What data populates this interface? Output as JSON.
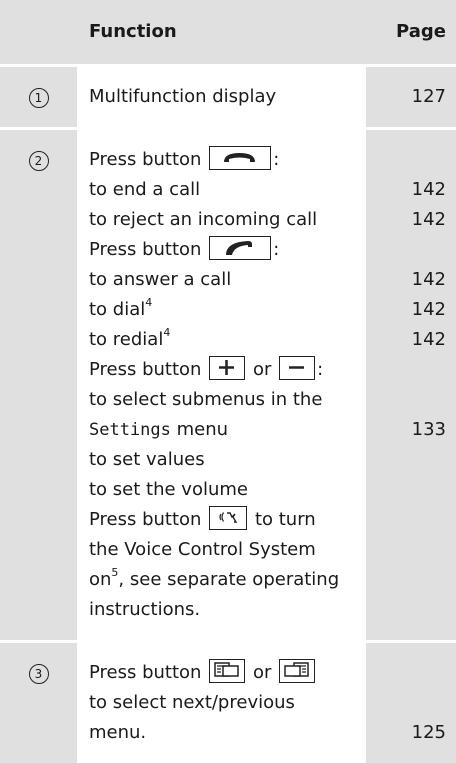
{
  "header": {
    "function": "Function",
    "page": "Page"
  },
  "rows": [
    {
      "num": "1",
      "lines": [
        {
          "t": "Multifunction display",
          "p": "127"
        }
      ]
    },
    {
      "num": "2",
      "lines": [
        {
          "pre": "Press button",
          "post": ":"
        },
        {
          "t": "to end a call",
          "p": "142"
        },
        {
          "t": "to reject an incoming call",
          "p": "142"
        },
        {
          "pre": "Press button",
          "post": ":"
        },
        {
          "t": "to answer a call",
          "p": "142"
        },
        {
          "t": "to dial",
          "sup": "4",
          "p": "142"
        },
        {
          "t": "to redial",
          "sup": "4",
          "p": "142"
        },
        {
          "pre": "Press button",
          "mid": "or",
          "post": ":"
        },
        {
          "t": "to select submenus in the"
        },
        {
          "mono": "Settings",
          "tail": "menu",
          "p": "133"
        },
        {
          "t": "to set values"
        },
        {
          "t": "to set the volume"
        },
        {
          "pre": "Press button",
          "post": "to turn"
        },
        {
          "t": "the Voice Control System"
        },
        {
          "t": "on",
          "sup": "5",
          "tail2": ", see separate operating"
        },
        {
          "t": "instructions."
        }
      ]
    },
    {
      "num": "3",
      "lines": [
        {
          "pre": "Press button",
          "mid": "or"
        },
        {
          "t": "to select next/previous"
        },
        {
          "t": "menu.",
          "p": "125"
        }
      ]
    }
  ],
  "icons": {
    "end_call": "phone-hangup-icon",
    "answer_call": "phone-answer-icon",
    "plus": "plus-icon",
    "minus": "minus-icon",
    "voice": "voice-control-icon",
    "next_menu": "menu-next-icon",
    "prev_menu": "menu-previous-icon"
  }
}
